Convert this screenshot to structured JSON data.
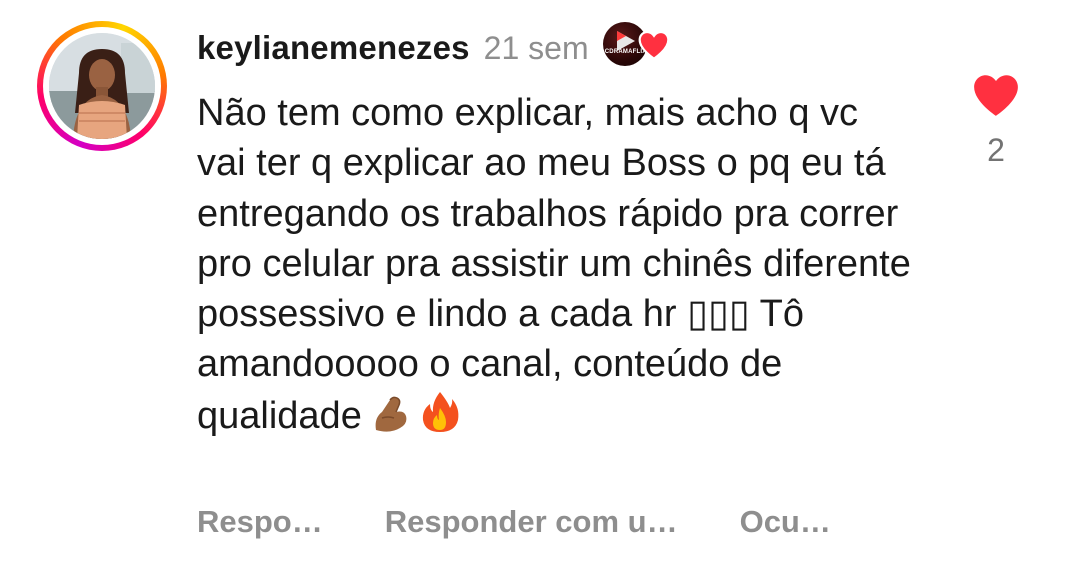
{
  "comment": {
    "username": "keylianemenezes",
    "time": "21 sem",
    "badge_label": "CDRAMAFLIX",
    "text": "Não tem como explicar, mais acho q vc vai ter q explicar ao meu Boss o pq eu tá entregando os trabalhos rápido pra correr pro celular pra assistir um chinês diferente possessivo e lindo a cada hr ▯▯▯ Tô amandooooo o canal, conteúdo de qualidade",
    "trailing_emojis": [
      "pinched-fingers-icon",
      "fire-icon"
    ],
    "like_count": "2",
    "actions": {
      "reply": "Respo…",
      "reply_with": "Responder com u…",
      "hide": "Ocu…"
    }
  },
  "colors": {
    "like_red": "#ff3040",
    "muted_text": "#8e8e8e",
    "story_ring": [
      "#d300c5",
      "#ff0069",
      "#ff7a00",
      "#ffd600"
    ]
  }
}
